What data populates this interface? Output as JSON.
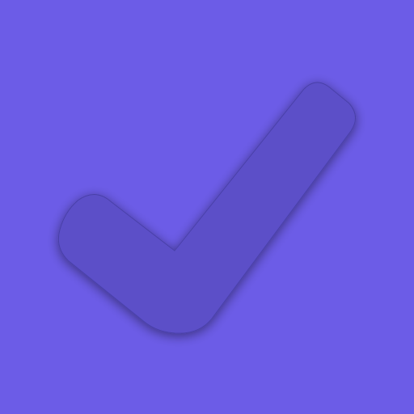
{
  "app": {
    "icon": "checkmark-icon"
  },
  "colors": {
    "background": "#6c5ce7",
    "checkmark_fill": "#5b4fc8",
    "checkmark_stroke": "#4a40a8",
    "checkmark_shadow": "#3b2fa0"
  }
}
